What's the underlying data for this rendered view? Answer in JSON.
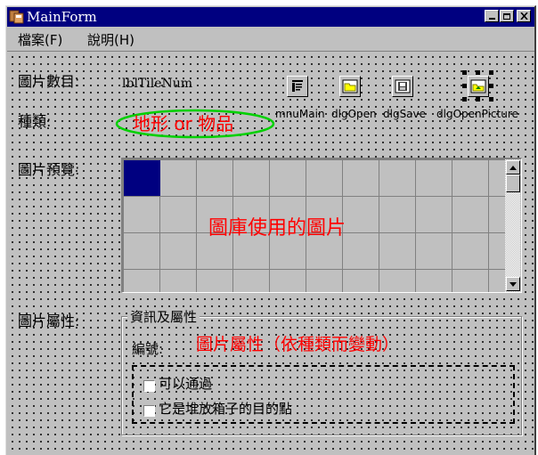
{
  "window": {
    "title": "MainForm"
  },
  "menu": [
    {
      "label": "檔案(F)"
    },
    {
      "label": "說明(H)"
    }
  ],
  "labels": {
    "tile_count": "圖片數目:",
    "tile_num_value": "lblTileNum",
    "category": "種類:",
    "category_annotation": "地形 or 物品",
    "preview": "圖片預覽:",
    "preview_annotation": "圖庫使用的圖片",
    "attributes": "圖片屬性:"
  },
  "components": [
    {
      "name": "mnuMain",
      "icon": "menu-component-icon"
    },
    {
      "name": "dlgOpen",
      "icon": "open-dialog-icon"
    },
    {
      "name": "dlgSave",
      "icon": "save-dialog-icon"
    },
    {
      "name": "dlgOpenPicture",
      "icon": "open-picture-dialog-icon"
    }
  ],
  "groupbox": {
    "title": "資訊及屬性",
    "id_label": "編號:",
    "id_annotation": "圖片屬性（依種類而變動）",
    "checkboxes": [
      {
        "label": "可以通過",
        "checked": false
      },
      {
        "label": "它是堆放箱子的目的點",
        "checked": false
      }
    ]
  },
  "colors": {
    "titlebar": "#000080",
    "annotation_red": "#ff0000",
    "ellipse_green": "#00d000"
  }
}
